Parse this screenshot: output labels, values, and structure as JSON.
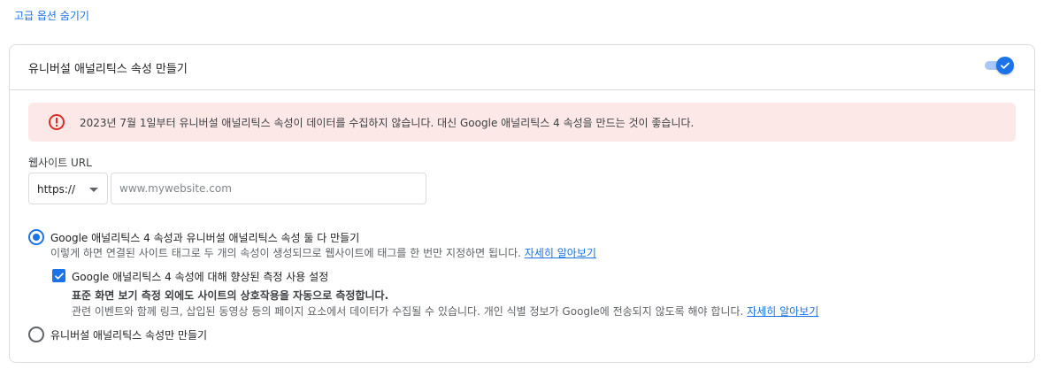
{
  "hide_advanced_link": "고급 옵션 숨기기",
  "card": {
    "title": "유니버설 애널리틱스 속성 만들기",
    "toggle_on": true,
    "alert": {
      "icon": "error-circle-icon",
      "text": "2023년 7월 1일부터 유니버설 애널리틱스 속성이 데이터를 수집하지 않습니다. 대신 Google 애널리틱스 4 속성을 만드는 것이 좋습니다."
    },
    "website_url": {
      "label": "웹사이트 URL",
      "scheme": "https://",
      "placeholder": "www.mywebsite.com"
    },
    "option_both": {
      "selected": true,
      "label": "Google 애널리틱스 4 속성과 유니버설 애널리틱스 속성 둘 다 만들기",
      "description": "이렇게 하면 연결된 사이트 태그로 두 개의 속성이 생성되므로 웹사이트에 태그를 한 번만 지정하면 됩니다.",
      "learn_more": "자세히 알아보기",
      "enhanced": {
        "checked": true,
        "label": "Google 애널리틱스 4 속성에 대해 향상된 측정 사용 설정",
        "bold_text": "표준 화면 보기 측정 외에도 사이트의 상호작용을 자동으로 측정합니다.",
        "description": "관련 이벤트와 함께 링크, 삽입된 동영상 등의 페이지 요소에서 데이터가 수집될 수 있습니다. 개인 식별 정보가 Google에 전송되지 않도록 해야 합니다.",
        "learn_more": "자세히 알아보기"
      }
    },
    "option_ua_only": {
      "selected": false,
      "label": "유니버설 애널리틱스 속성만 만들기"
    }
  },
  "colors": {
    "accent": "#1a73e8",
    "alert_bg": "#fce8e6",
    "alert_icon": "#d93025"
  }
}
